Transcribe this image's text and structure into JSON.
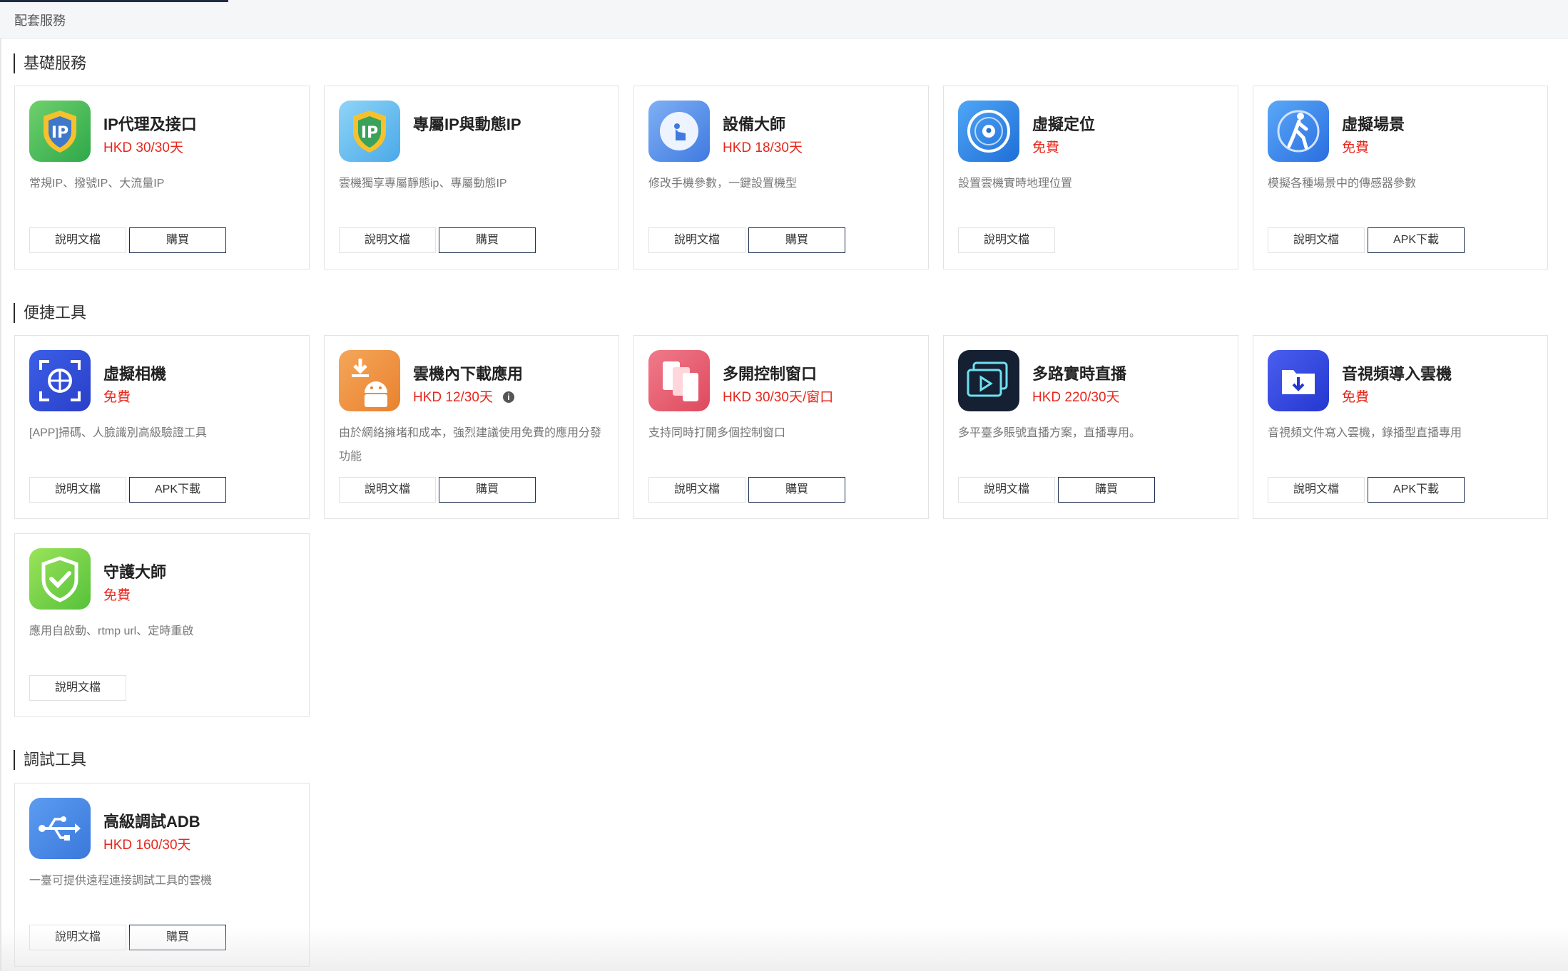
{
  "header": {
    "title": "配套服務"
  },
  "labels": {
    "doc": "說明文檔",
    "buy": "購買",
    "apk": "APK下載"
  },
  "sections": [
    {
      "title": "基礎服務",
      "cards": [
        {
          "name": "IP代理及接口",
          "price": "HKD 30/30天",
          "desc": "常規IP、撥號IP、大流量IP",
          "icon": "ip-shield-icon"
        },
        {
          "name": "專屬IP與動態IP",
          "price": "",
          "desc": "雲機獨享專屬靜態ip、專屬動態IP",
          "icon": "ip-shield-icon"
        },
        {
          "name": "設備大師",
          "price": "HKD 18/30天",
          "desc": "修改手機參數，一鍵設置機型",
          "icon": "touch-icon"
        },
        {
          "name": "虛擬定位",
          "price": "免費",
          "desc": "設置雲機實時地理位置",
          "icon": "location-radar-icon"
        },
        {
          "name": "虛擬場景",
          "price": "免費",
          "desc": "模擬各種場景中的傳感器參數",
          "icon": "walking-person-icon"
        }
      ]
    },
    {
      "title": "便捷工具",
      "cards": [
        {
          "name": "虛擬相機",
          "price": "免費",
          "desc": "[APP]掃碼、人臉識別高級驗證工具",
          "icon": "camera-scan-icon"
        },
        {
          "name": "雲機內下載應用",
          "price": "HKD 12/30天",
          "desc": "由於網絡擁堵和成本，強烈建議使用免費的應用分發功能",
          "icon": "android-download-icon",
          "info": "i"
        },
        {
          "name": "多開控制窗口",
          "price": "HKD 30/30天/窗口",
          "desc": "支持同時打開多個控制窗口",
          "icon": "multi-window-icon"
        },
        {
          "name": "多路實時直播",
          "price": "HKD 220/30天",
          "desc": "多平臺多賬號直播方案，直播專用。",
          "icon": "live-stream-icon"
        },
        {
          "name": "音視頻導入雲機",
          "price": "免費",
          "desc": "音視頻文件寫入雲機，錄播型直播專用",
          "icon": "folder-download-icon"
        }
      ]
    },
    {
      "cards": [
        {
          "name": "守護大師",
          "price": "免費",
          "desc": "應用自啟動、rtmp url、定時重啟",
          "icon": "shield-check-icon"
        }
      ]
    },
    {
      "title": "調試工具",
      "cards": [
        {
          "name": "高級調試ADB",
          "price": "HKD 160/30天",
          "desc": "一臺可提供遠程連接調試工具的雲機",
          "icon": "usb-icon"
        }
      ]
    }
  ]
}
